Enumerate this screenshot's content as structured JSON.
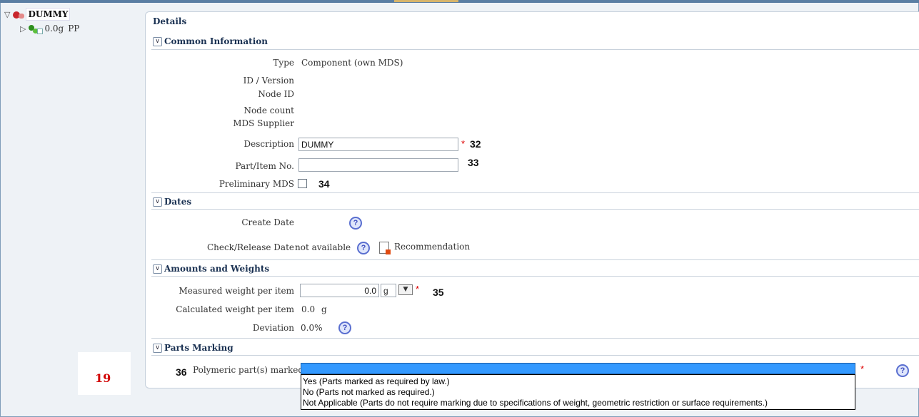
{
  "tree": {
    "root_label": "DUMMY",
    "child_weight": "0.0g",
    "child_label": "PP"
  },
  "details": {
    "title": "Details",
    "common": {
      "header": "Common Information",
      "type_label": "Type",
      "type_value": "Component (own MDS)",
      "id_version_label": "ID / Version",
      "node_id_label": "Node ID",
      "node_count_label": "Node count",
      "mds_supplier_label": "MDS Supplier",
      "description_label": "Description",
      "description_value": "DUMMY",
      "part_item_label": "Part/Item No.",
      "part_item_value": "",
      "preliminary_label": "Preliminary MDS"
    },
    "dates": {
      "header": "Dates",
      "create_date_label": "Create Date",
      "check_release_label": "Check/Release Date",
      "check_release_value": "not available",
      "recommendation_label": "Recommendation"
    },
    "amounts": {
      "header": "Amounts and Weights",
      "measured_label": "Measured weight per item",
      "measured_value": "0.0",
      "measured_unit": "g",
      "calculated_label": "Calculated weight per item",
      "calculated_value": "0.0",
      "calculated_unit": "g",
      "deviation_label": "Deviation",
      "deviation_value": "0.0%"
    },
    "marking": {
      "header": "Parts Marking",
      "polymeric_label": "Polymeric part(s) marked",
      "options": [
        "Yes (Parts marked as required by law.)",
        "No (Parts not marked as required.)",
        "Not Applicable (Parts do not require marking due to specifications of weight, geometric restriction or surface requirements.)"
      ]
    }
  },
  "annotations": {
    "n32": "32",
    "n33": "33",
    "n34": "34",
    "n35": "35",
    "n36": "36",
    "n19": "19"
  },
  "icons": {
    "required": "*",
    "help": "?",
    "collapse": "∨",
    "tree_expanded": "▽",
    "tree_collapsed": "▷",
    "dropdown": "▼"
  }
}
